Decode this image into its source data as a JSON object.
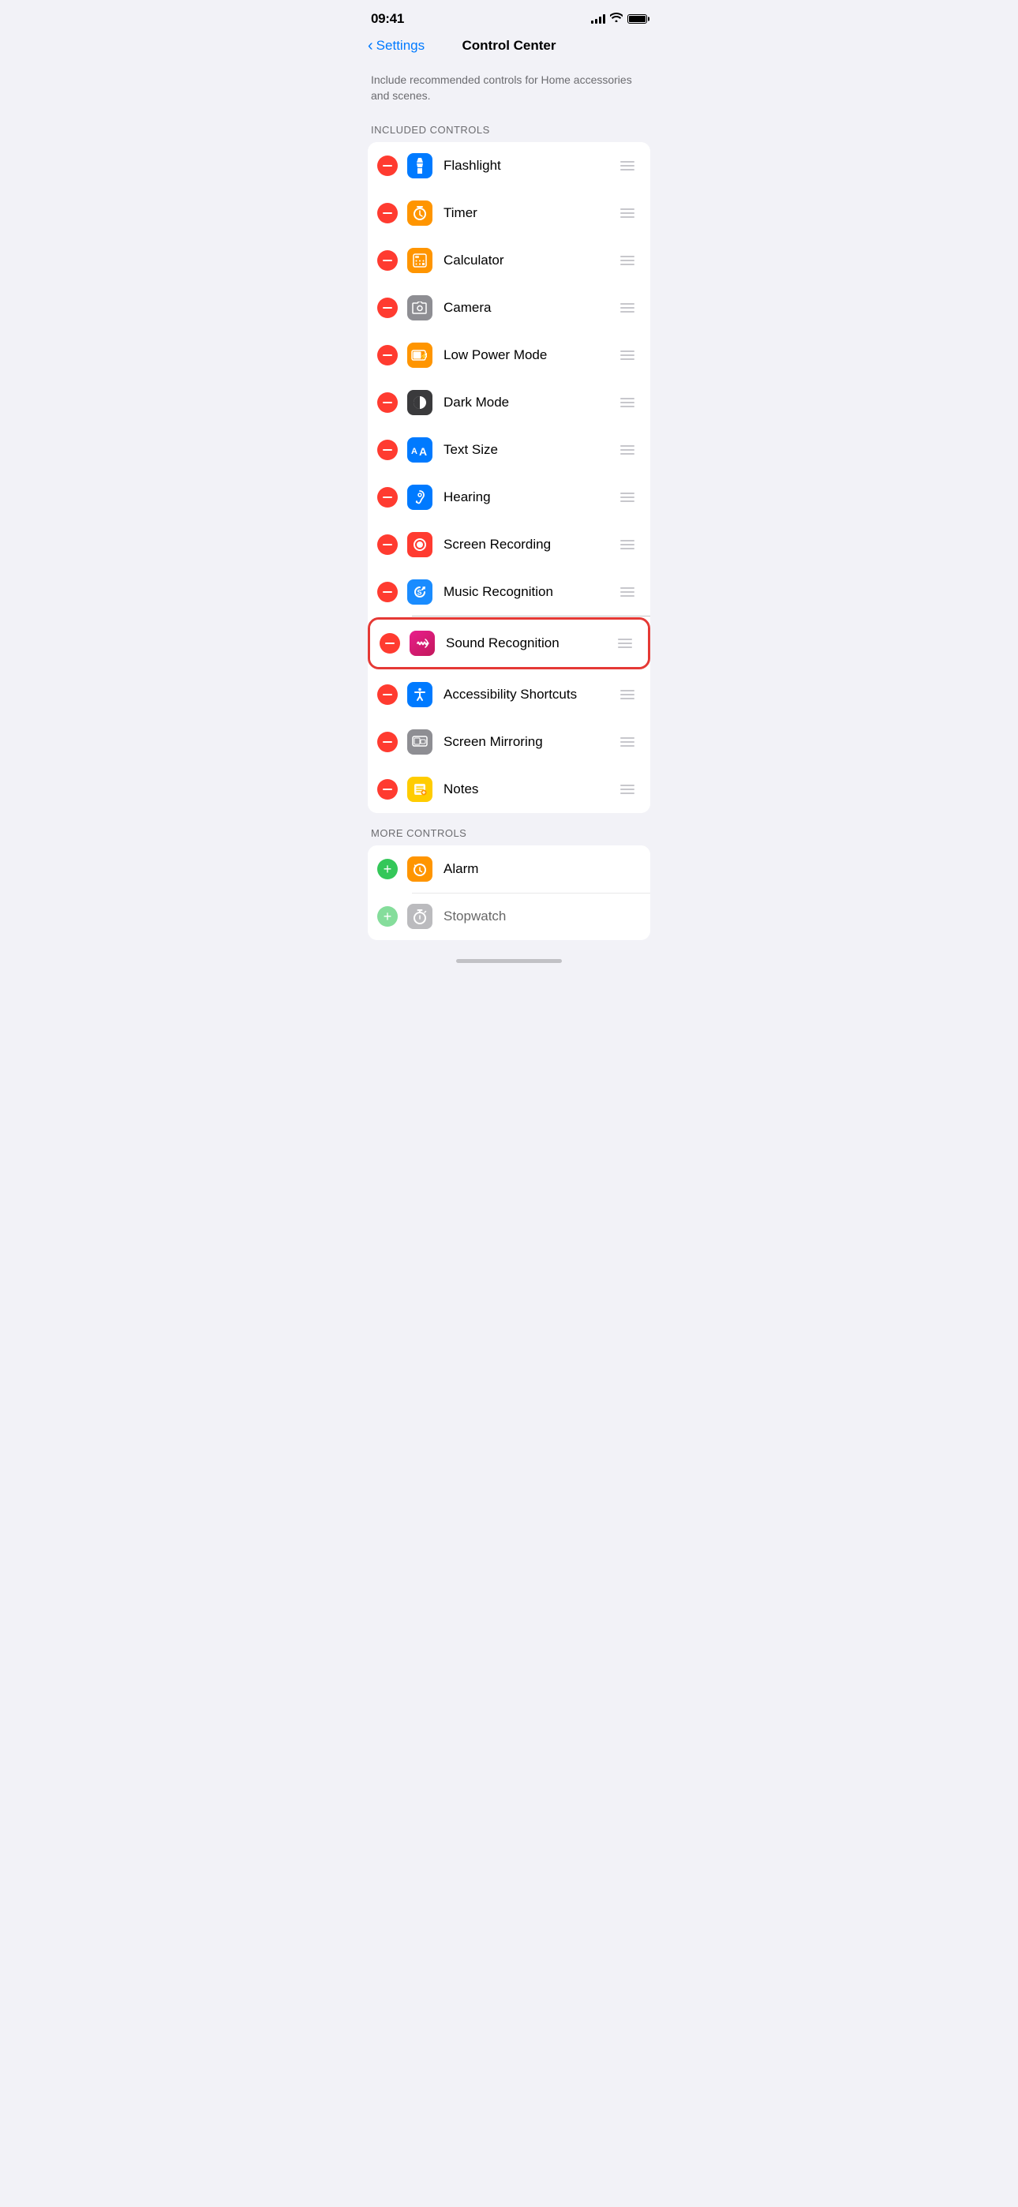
{
  "statusBar": {
    "time": "09:41",
    "battery": 100
  },
  "navigation": {
    "backLabel": "Settings",
    "title": "Control Center"
  },
  "description": "Include recommended controls for Home accessories and scenes.",
  "sections": {
    "included": {
      "header": "INCLUDED CONTROLS",
      "items": [
        {
          "id": "flashlight",
          "label": "Flashlight",
          "iconBg": "#007aff",
          "iconType": "flashlight"
        },
        {
          "id": "timer",
          "label": "Timer",
          "iconBg": "#ff9500",
          "iconType": "timer"
        },
        {
          "id": "calculator",
          "label": "Calculator",
          "iconBg": "#ff9500",
          "iconType": "calculator"
        },
        {
          "id": "camera",
          "label": "Camera",
          "iconBg": "#8e8e93",
          "iconType": "camera"
        },
        {
          "id": "low-power",
          "label": "Low Power Mode",
          "iconBg": "#ff9500",
          "iconType": "battery"
        },
        {
          "id": "dark-mode",
          "label": "Dark Mode",
          "iconBg": "#3a3a3c",
          "iconType": "darkmode"
        },
        {
          "id": "text-size",
          "label": "Text Size",
          "iconBg": "#007aff",
          "iconType": "textsize"
        },
        {
          "id": "hearing",
          "label": "Hearing",
          "iconBg": "#007aff",
          "iconType": "hearing"
        },
        {
          "id": "screen-recording",
          "label": "Screen Recording",
          "iconBg": "#ff3b30",
          "iconType": "record"
        },
        {
          "id": "music-recognition",
          "label": "Music Recognition",
          "iconBg": "#1a8cff",
          "iconType": "shazam"
        },
        {
          "id": "sound-recognition",
          "label": "Sound Recognition",
          "iconBg": "pink-gradient",
          "iconType": "soundrecog",
          "highlighted": true
        },
        {
          "id": "accessibility",
          "label": "Accessibility Shortcuts",
          "iconBg": "#007aff",
          "iconType": "accessibility"
        },
        {
          "id": "screen-mirroring",
          "label": "Screen Mirroring",
          "iconBg": "#8e8e93",
          "iconType": "mirror"
        },
        {
          "id": "notes",
          "label": "Notes",
          "iconBg": "#ffcc00",
          "iconType": "notes"
        }
      ]
    },
    "more": {
      "header": "MORE CONTROLS",
      "items": [
        {
          "id": "alarm",
          "label": "Alarm",
          "iconBg": "#ff9500",
          "iconType": "alarm",
          "action": "add"
        },
        {
          "id": "stopwatch",
          "label": "Stopwatch",
          "iconBg": "#8e8e93",
          "iconType": "stopwatch",
          "action": "add"
        }
      ]
    }
  }
}
